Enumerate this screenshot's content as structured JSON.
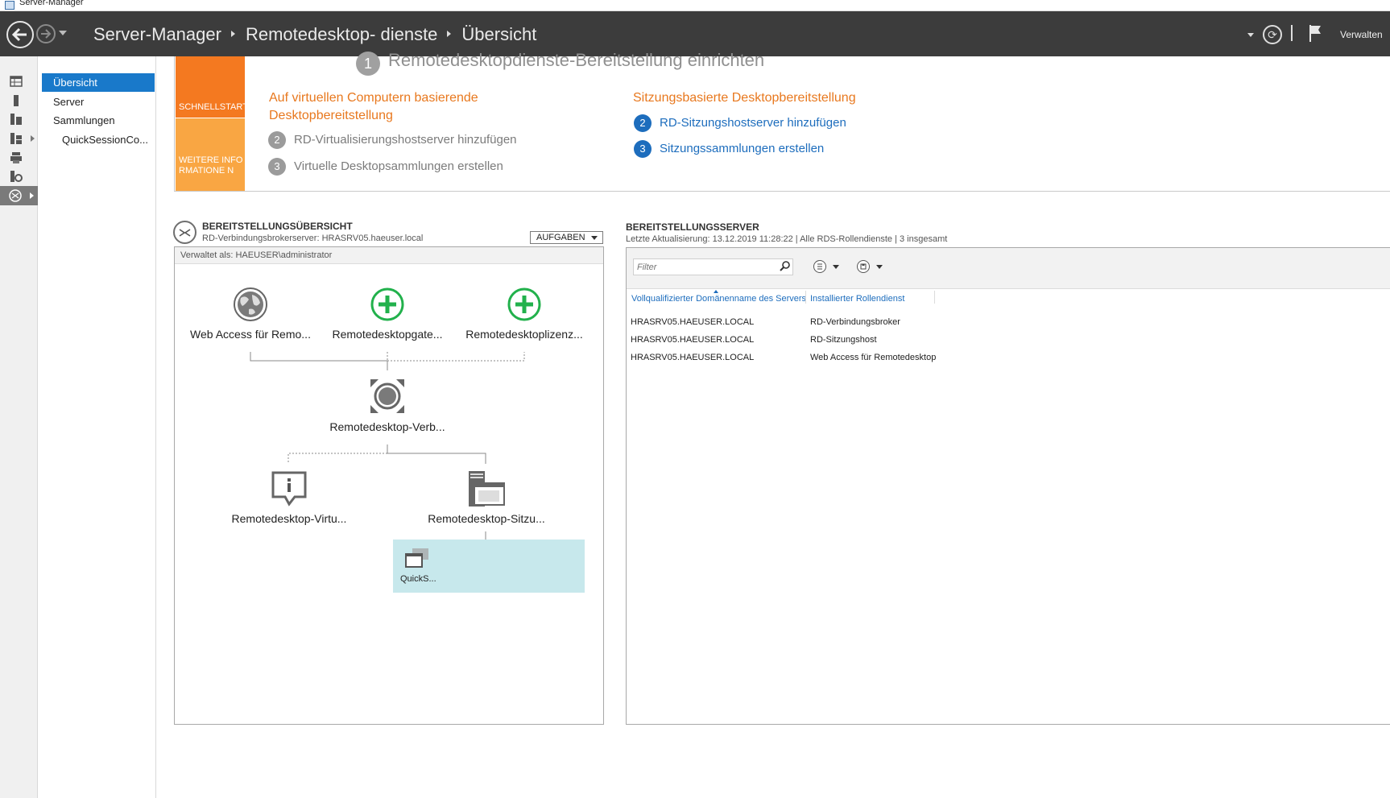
{
  "window": {
    "title": "Server-Manager"
  },
  "header": {
    "breadcrumb": [
      "Server-Manager",
      "Remotedesktop- dienste",
      "Übersicht"
    ],
    "manage_label": "Verwalten"
  },
  "nav": {
    "items": [
      {
        "label": "Übersicht",
        "selected": true
      },
      {
        "label": "Server"
      },
      {
        "label": "Sammlungen"
      },
      {
        "label": "QuickSessionCo..."
      }
    ]
  },
  "quickstart": {
    "tiles": [
      "SCHNELLSTART",
      "WEITERE INFORMATIONE N"
    ],
    "step1": {
      "num": "1",
      "title": "Remotedesktopdienste-Bereitstellung einrichten"
    },
    "vm_column": {
      "title": "Auf virtuellen Computern basierende Desktopbereitstellung",
      "steps": [
        {
          "num": "2",
          "text": "RD-Virtualisierungshostserver hinzufügen"
        },
        {
          "num": "3",
          "text": "Virtuelle Desktopsammlungen erstellen"
        }
      ]
    },
    "session_column": {
      "title": "Sitzungsbasierte Desktopbereitstellung",
      "steps": [
        {
          "num": "2",
          "text": "RD-Sitzungshostserver hinzufügen"
        },
        {
          "num": "3",
          "text": "Sitzungssammlungen erstellen"
        }
      ]
    }
  },
  "overview": {
    "title": "BEREITSTELLUNGSÜBERSICHT",
    "subtitle": "RD-Verbindungsbrokerserver: HRASRV05.haeuser.local",
    "tasks_label": "AUFGABEN",
    "managed_as": "Verwaltet als: HAEUSER\\administrator",
    "nodes": [
      {
        "label": "Web Access für Remo...",
        "icon": "globe-icon"
      },
      {
        "label": "Remotedesktopgate...",
        "icon": "plus-circle-icon"
      },
      {
        "label": "Remotedesktoplizenz...",
        "icon": "plus-circle-icon"
      },
      {
        "label": "Remotedesktop-Verb...",
        "icon": "broker-icon"
      },
      {
        "label": "Remotedesktop-Virtu...",
        "icon": "info-bubble-icon"
      },
      {
        "label": "Remotedesktop-Sitzu...",
        "icon": "session-host-icon"
      }
    ],
    "collection_label": "QuickS..."
  },
  "servers": {
    "title": "BEREITSTELLUNGSSERVER",
    "subtitle": "Letzte Aktualisierung: 13.12.2019 11:28:22 | Alle RDS-Rollendienste  | 3 insgesamt",
    "filter_placeholder": "Filter",
    "columns": [
      "Vollqualifizierter Domänenname des Servers",
      "Installierter Rollendienst"
    ],
    "rows": [
      [
        "HRASRV05.HAEUSER.LOCAL",
        "RD-Verbindungsbroker"
      ],
      [
        "HRASRV05.HAEUSER.LOCAL",
        "RD-Sitzungshost"
      ],
      [
        "HRASRV05.HAEUSER.LOCAL",
        "Web Access für Remotedesktop"
      ]
    ]
  },
  "colors": {
    "header_bg": "#3c3c3c",
    "accent_blue": "#1979ca",
    "orange": "#f47920",
    "light_orange": "#f9a643",
    "link_blue": "#1d6dbd",
    "green": "#22b14c",
    "collection_bg": "#c7e8ec"
  }
}
